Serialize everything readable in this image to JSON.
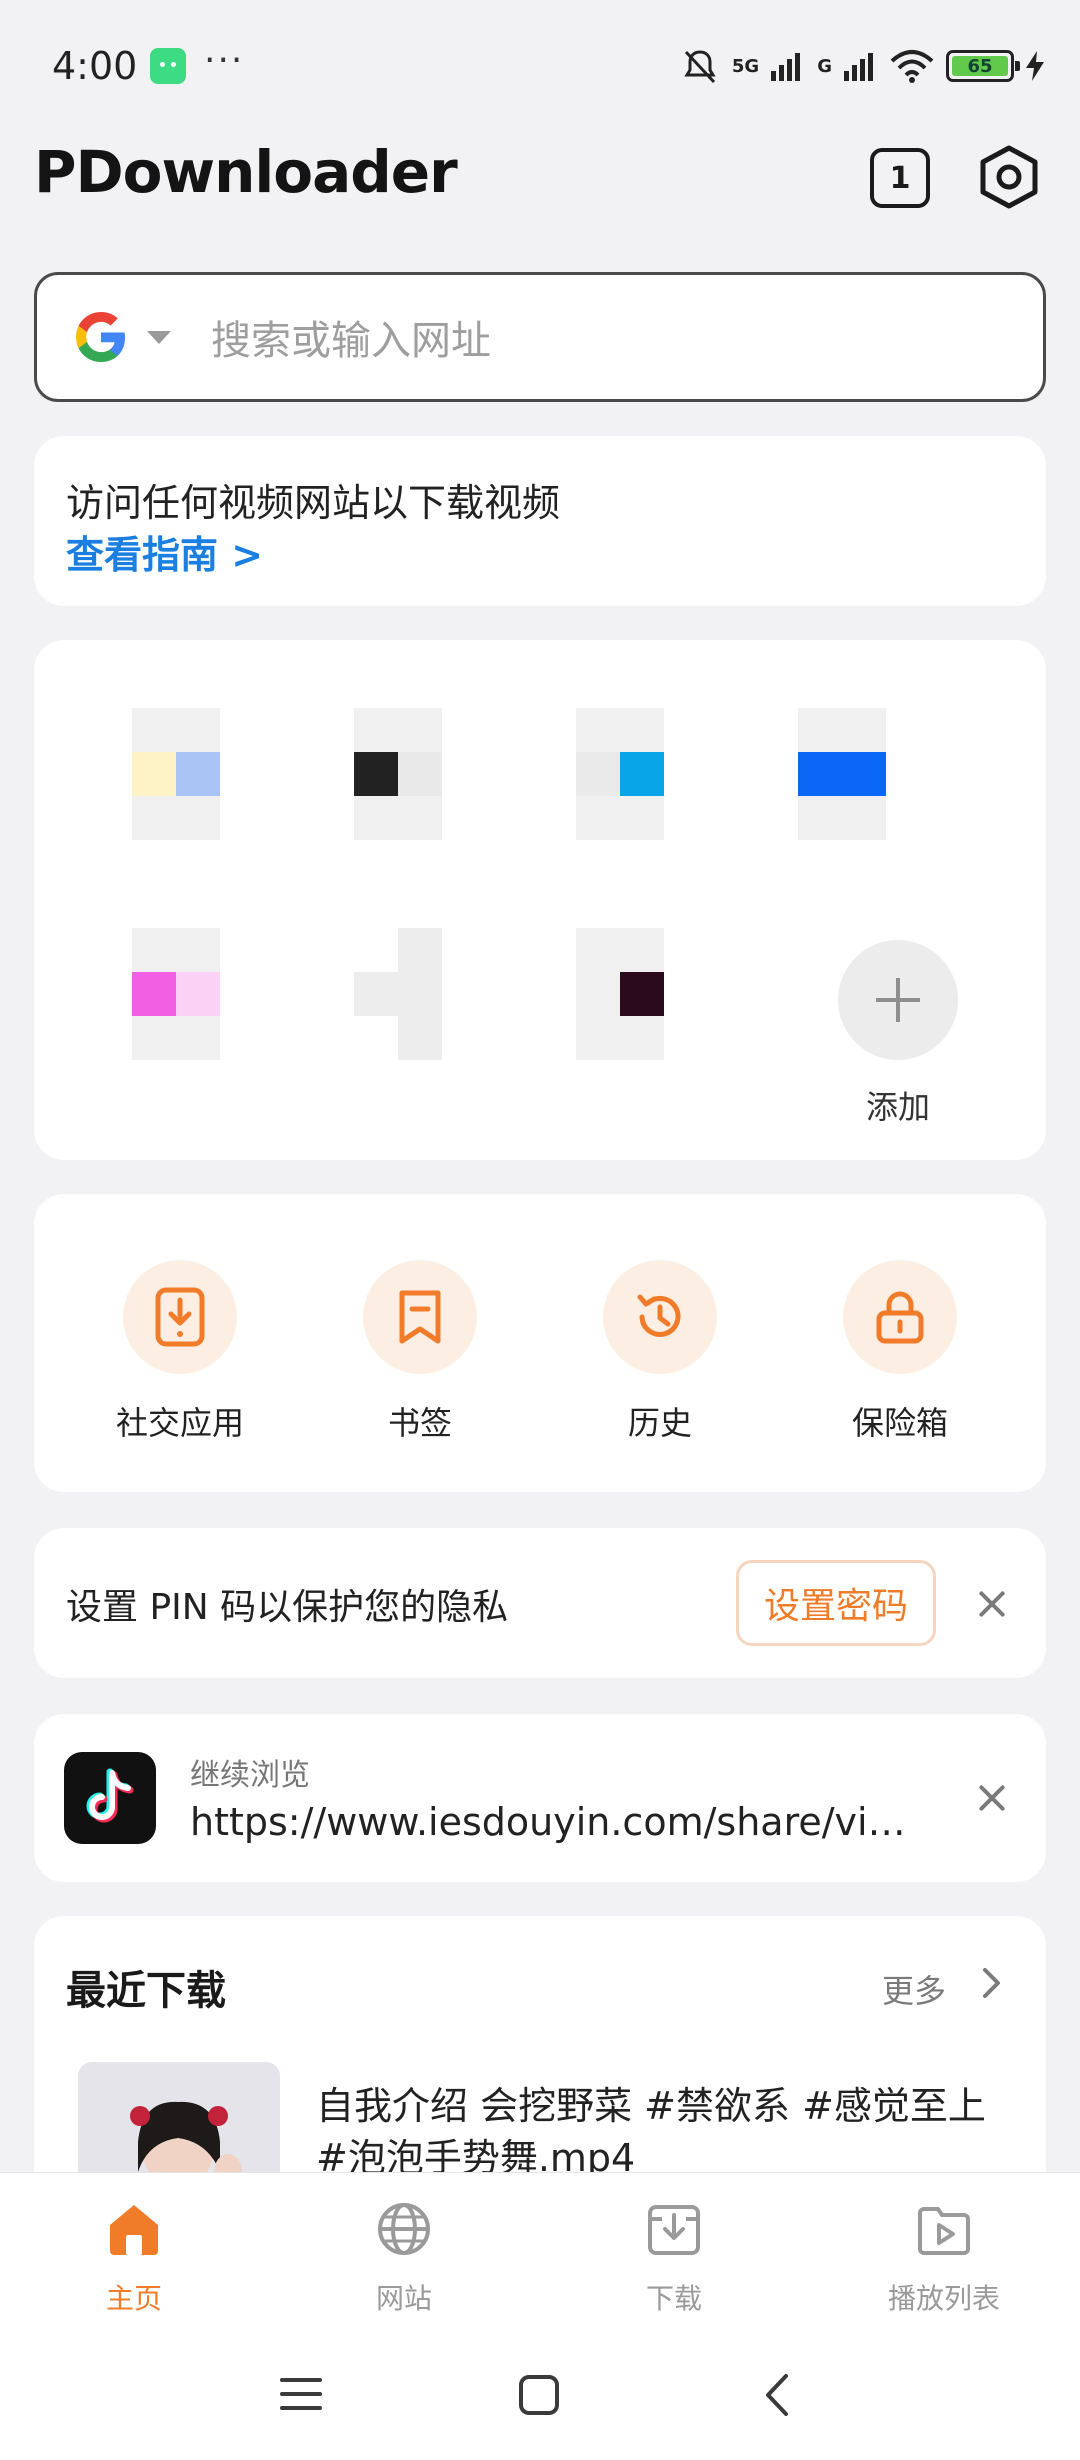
{
  "status_bar": {
    "time": "4:00",
    "dots": "···",
    "network": "5G",
    "network2": "G",
    "battery": "65"
  },
  "header": {
    "app_title": "PDownloader",
    "tab_count": "1"
  },
  "search": {
    "placeholder": "搜索或输入网址"
  },
  "guide": {
    "text": "访问任何视频网站以下载视频",
    "link": "查看指南 >"
  },
  "shortcuts": {
    "add_label": "添加"
  },
  "tools": [
    {
      "label": "社交应用",
      "icon": "phone-download-icon"
    },
    {
      "label": "书签",
      "icon": "bookmark-icon"
    },
    {
      "label": "历史",
      "icon": "history-icon"
    },
    {
      "label": "保险箱",
      "icon": "lock-icon"
    }
  ],
  "pin": {
    "text": "设置 PIN 码以保护您的隐私",
    "button": "设置密码"
  },
  "continue": {
    "label": "继续浏览",
    "url": "https://www.iesdouyin.com/share/video/"
  },
  "recent": {
    "title": "最近下载",
    "more": "更多",
    "item_name": "自我介绍 会挖野菜 #禁欲系 #感觉至上 #泡泡手势舞.mp4"
  },
  "bottom_nav": [
    {
      "label": "主页",
      "icon": "home-icon",
      "active": true
    },
    {
      "label": "网站",
      "icon": "globe-icon",
      "active": false
    },
    {
      "label": "下载",
      "icon": "download-tray-icon",
      "active": false
    },
    {
      "label": "播放列表",
      "icon": "playlist-icon",
      "active": false
    }
  ],
  "colors": {
    "accent": "#f07c2a",
    "link": "#1a7fe0",
    "background": "#f2f2f4"
  }
}
